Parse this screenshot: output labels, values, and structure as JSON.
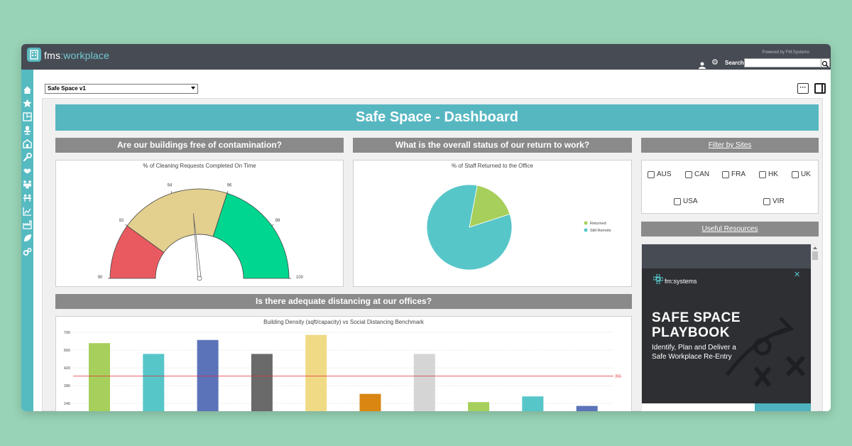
{
  "app": {
    "logo_brand": "fms",
    "logo_colon": ":",
    "logo_product": "workplace",
    "powered_by": "Powered by FM:Systems",
    "search_label": "Search",
    "search_value": ""
  },
  "toolbar": {
    "dashboard_select": "Safe Space v1",
    "more_label": "···"
  },
  "dashboard": {
    "title": "Safe Space - Dashboard",
    "section_contamination": "Are our buildings free of contamination?",
    "section_return": "What is the overall status of our return to work?",
    "section_distancing": "Is there adequate distancing at our offices?",
    "filter_header": "Filter by Sites",
    "resources_header": "Useful Resources"
  },
  "gauge": {
    "title": "% of Cleaning Requests Completed On Time",
    "min": 90,
    "max": 100,
    "value": 94.7,
    "ticks": [
      90,
      92,
      94,
      96,
      98,
      100
    ],
    "bands": [
      {
        "from": 90,
        "to": 92,
        "color": "#e95a60"
      },
      {
        "from": 92,
        "to": 96,
        "color": "#e3cf8e"
      },
      {
        "from": 96,
        "to": 100,
        "color": "#00d68f"
      }
    ]
  },
  "pie": {
    "title": "% of Staff Returned to the Office",
    "slices": [
      {
        "name": "Returned",
        "value": 17,
        "color": "#a6cf5b"
      },
      {
        "name": "Still Remote",
        "value": 83,
        "color": "#57c6c9"
      }
    ]
  },
  "filters": {
    "sites": [
      "AUS",
      "CAN",
      "FRA",
      "HK",
      "UK",
      "USA",
      "VIR"
    ]
  },
  "promo": {
    "brand": "fm:systems",
    "headline_1": "SAFE SPACE",
    "headline_2": "PLAYBOOK",
    "sub_1": "Identify, Plan and Deliver a",
    "sub_2": "Safe Workplace Re-Entry",
    "close": "✕"
  },
  "chart_data": {
    "type": "bar",
    "title": "Building Density (sqft/capacity) vs Social Distancing Benchmark",
    "ylim": [
      0,
      700
    ],
    "yticks": [
      140,
      280,
      420,
      560,
      700
    ],
    "benchmark": 355,
    "benchmark_label": "355",
    "values": [
      615,
      530,
      640,
      530,
      680,
      215,
      530,
      150,
      195,
      120
    ],
    "colors": [
      "#a6cf5b",
      "#57c6c9",
      "#5b73b8",
      "#6a6a6a",
      "#f0da86",
      "#d98612",
      "#d5d5d5",
      "#a6cf5b",
      "#57c6c9",
      "#5b73b8"
    ]
  }
}
